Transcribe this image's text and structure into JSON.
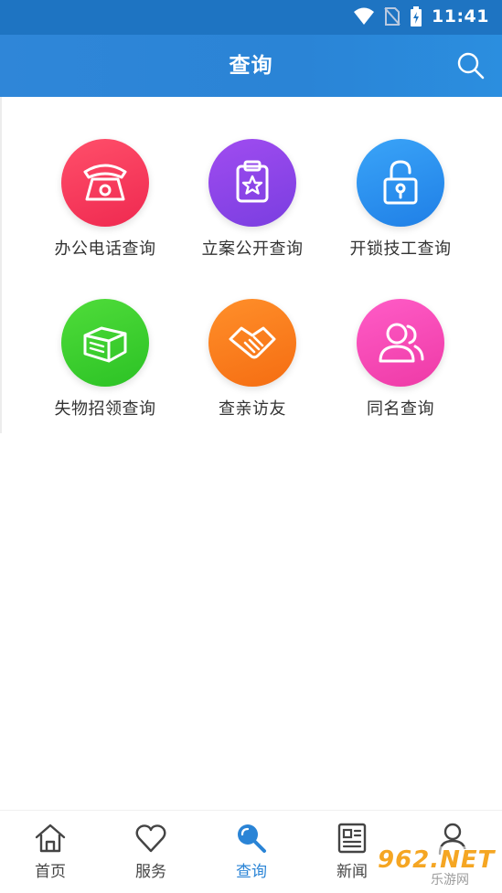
{
  "status_bar": {
    "time": "11:41"
  },
  "header": {
    "title": "查询"
  },
  "grid": {
    "items": [
      {
        "label": "办公电话查询",
        "icon": "telephone-icon",
        "color": "#f5365c"
      },
      {
        "label": "立案公开查询",
        "icon": "clipboard-star-icon",
        "color": "#8b46e8"
      },
      {
        "label": "开锁技工查询",
        "icon": "unlock-icon",
        "color": "#2c8ff0"
      },
      {
        "label": "失物招领查询",
        "icon": "box-icon",
        "color": "#3bcf2e"
      },
      {
        "label": "查亲访友",
        "icon": "handshake-icon",
        "color": "#ff7d1f"
      },
      {
        "label": "同名查询",
        "icon": "users-icon",
        "color": "#f546b4"
      }
    ]
  },
  "bottom_nav": {
    "items": [
      {
        "label": "首页",
        "icon": "home-icon"
      },
      {
        "label": "服务",
        "icon": "heart-icon"
      },
      {
        "label": "查询",
        "icon": "search-icon"
      },
      {
        "label": "新闻",
        "icon": "news-icon"
      },
      {
        "label": "",
        "icon": "user-icon"
      }
    ],
    "active_index": 2
  },
  "watermark": {
    "brand": "962.NET",
    "sub": "乐游网"
  }
}
